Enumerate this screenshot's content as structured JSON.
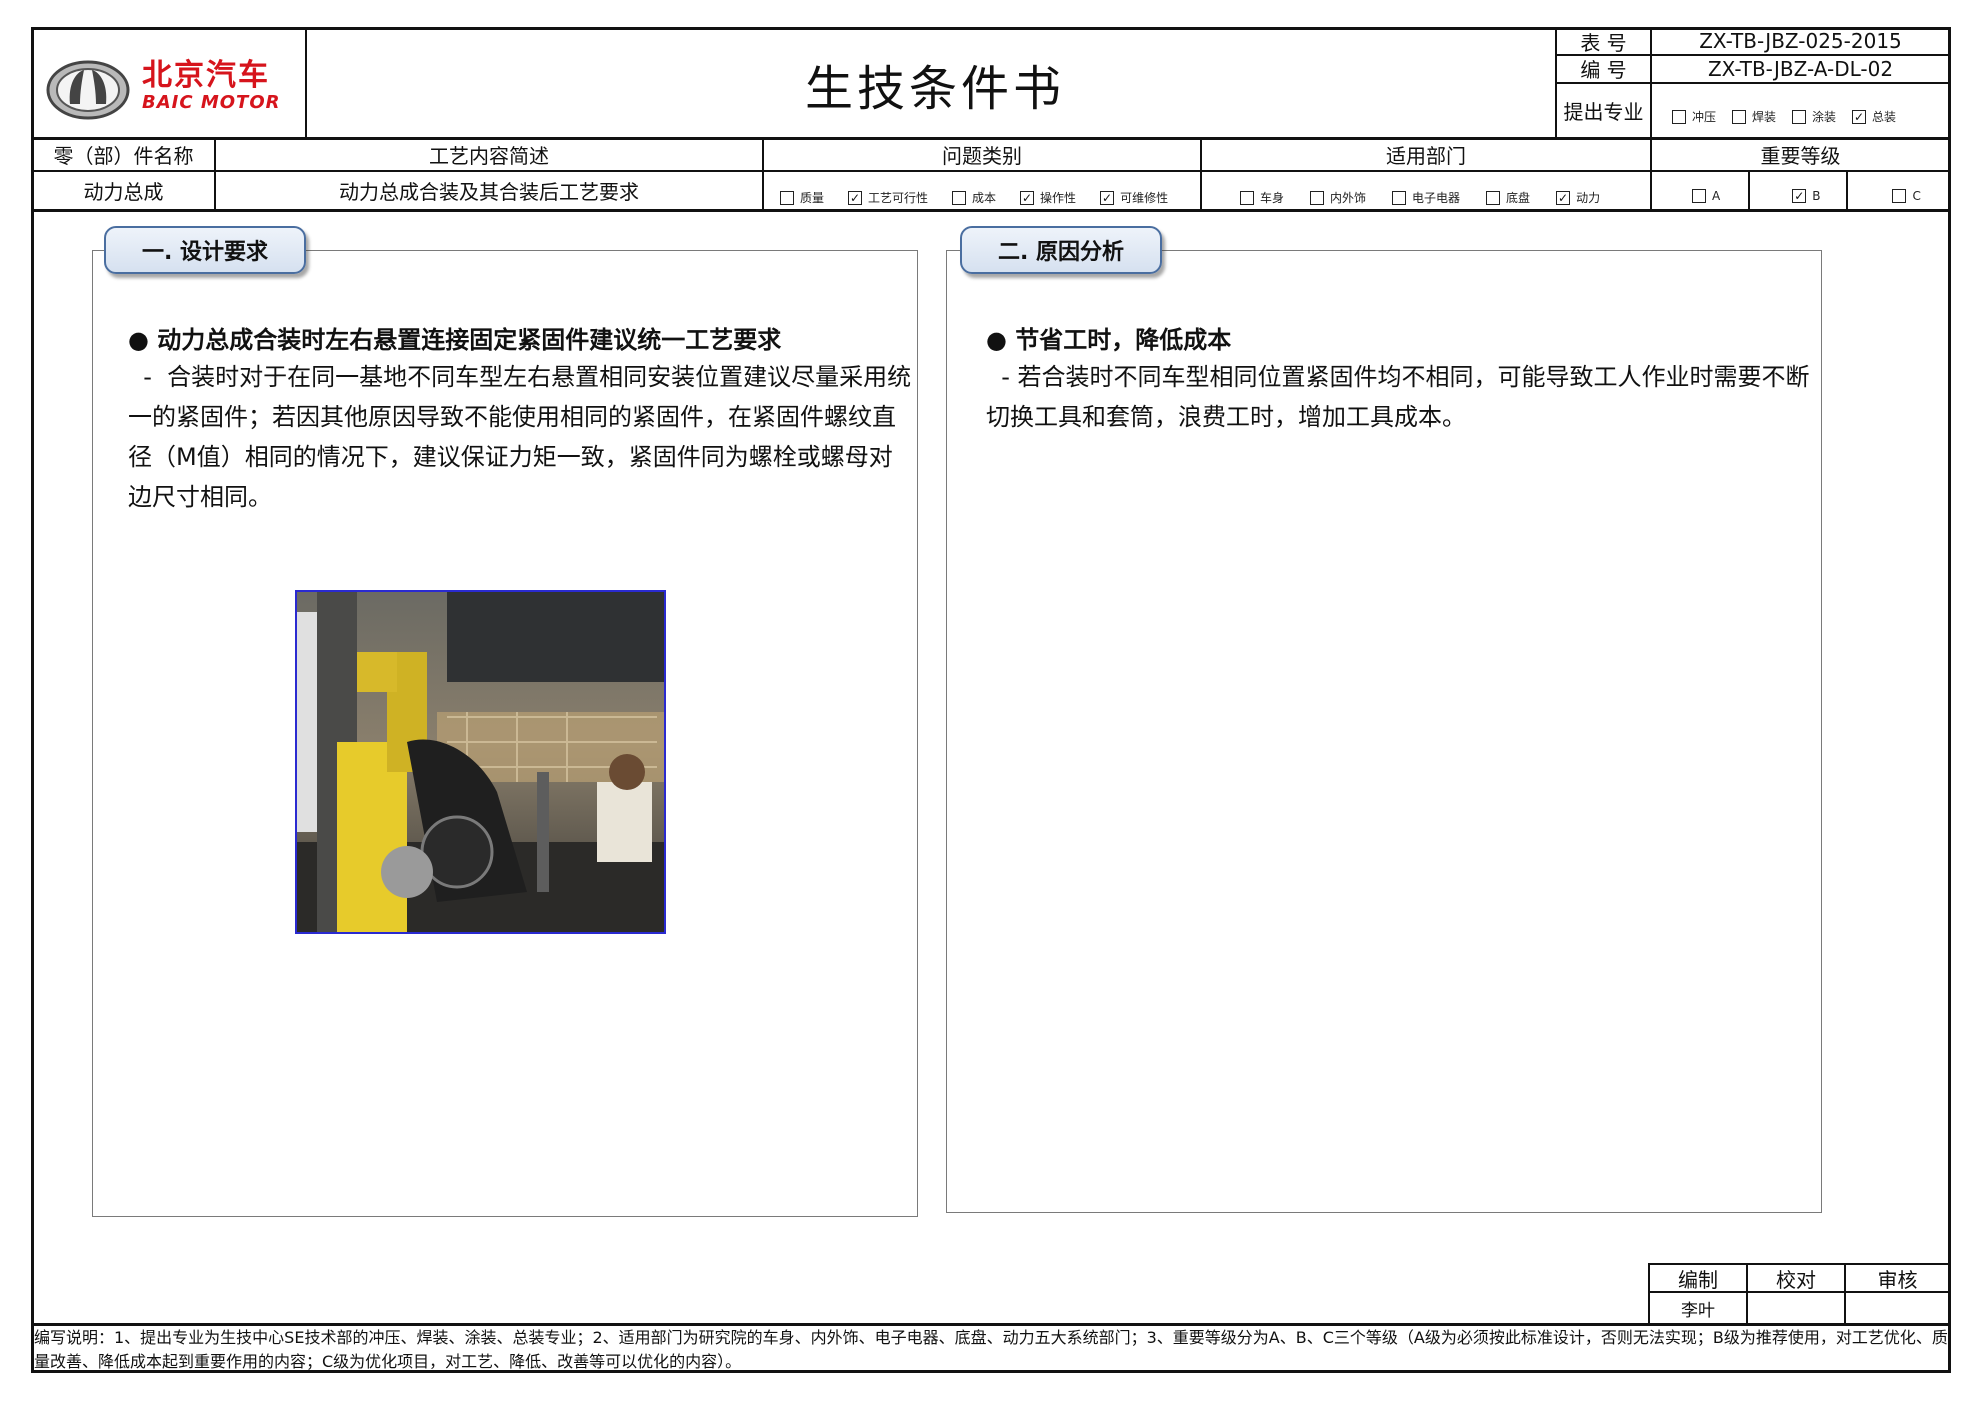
{
  "header": {
    "brand_cn": "北京汽车",
    "brand_en": "BAIC MOTOR",
    "title": "生技条件书",
    "form_no_label": "表 号",
    "form_no": "ZX-TB-JBZ-025-2015",
    "doc_no_label": "编 号",
    "doc_no": "ZX-TB-JBZ-A-DL-02",
    "specialty_label": "提出专业",
    "specialties": [
      {
        "label": "冲压",
        "checked": false
      },
      {
        "label": "焊装",
        "checked": false
      },
      {
        "label": "涂装",
        "checked": false
      },
      {
        "label": "总装",
        "checked": true
      }
    ]
  },
  "info_row": {
    "part_name_header": "零（部）件名称",
    "process_header": "工艺内容简述",
    "issue_header": "问题类别",
    "dept_header": "适用部门",
    "level_header": "重要等级",
    "part_name": "动力总成",
    "process": "动力总成合装及其合装后工艺要求",
    "issues": [
      {
        "label": "质量",
        "checked": false
      },
      {
        "label": "工艺可行性",
        "checked": true
      },
      {
        "label": "成本",
        "checked": false
      },
      {
        "label": "操作性",
        "checked": true
      },
      {
        "label": "可维修性",
        "checked": true
      }
    ],
    "depts": [
      {
        "label": "车身",
        "checked": false
      },
      {
        "label": "内外饰",
        "checked": false
      },
      {
        "label": "电子电器",
        "checked": false
      },
      {
        "label": "底盘",
        "checked": false
      },
      {
        "label": "动力",
        "checked": true
      }
    ],
    "levels": [
      {
        "label": "A",
        "checked": false
      },
      {
        "label": "B",
        "checked": true
      },
      {
        "label": "C",
        "checked": false
      }
    ]
  },
  "design": {
    "tab": "一. 设计要求",
    "bullet": "● 动力总成合装时左右悬置连接固定紧固件建议统一工艺要求",
    "lines": [
      "  -  合装时对于在同一基地不同车型左右悬置相同安装位置建议尽量采用统",
      "一的紧固件；若因其他原因导致不能使用相同的紧固件，在紧固件螺纹直",
      "径（M值）相同的情况下，建议保证力矩一致，紧固件同为螺栓或螺母对",
      "边尺寸相同。"
    ]
  },
  "analysis": {
    "tab": "二. 原因分析",
    "bullet": "● 节省工时，降低成本",
    "lines": [
      "  - 若合装时不同车型相同位置紧固件均不相同，可能导致工人作业时需要不断",
      "切换工具和套筒，浪费工时，增加工具成本。"
    ]
  },
  "signoff": {
    "compile_label": "编制",
    "check_label": "校对",
    "review_label": "审核",
    "compiler": "李叶",
    "checker": "",
    "reviewer": ""
  },
  "footer_note": "编写说明：1、提出专业为生技中心SE技术部的冲压、焊装、涂装、总装专业；2、适用部门为研究院的车身、内外饰、电子电器、底盘、动力五大系统部门；3、重要等级分为A、B、C三个等级（A级为必须按此标准设计，否则无法实现；B级为推荐使用，对工艺优化、质量改善、降低成本起到重要作用的内容；C级为优化项目，对工艺、降低、改善等可以优化的内容）。",
  "colors": {
    "brand_red": "#d6141c",
    "tab_border": "#4a6ea0",
    "photo_border": "#2a2ad0"
  }
}
